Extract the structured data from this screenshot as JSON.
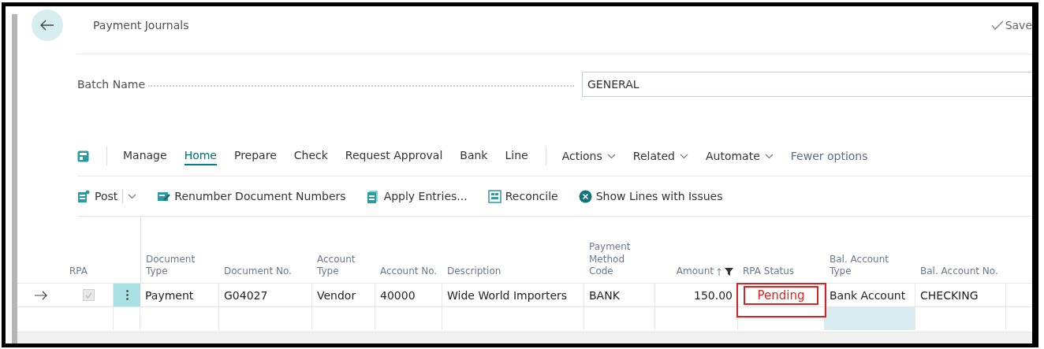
{
  "header": {
    "title": "Payment Journals",
    "save_status": "Save"
  },
  "batch": {
    "label": "Batch Name",
    "value": "GENERAL"
  },
  "action_bar": [
    {
      "kind": "icon"
    },
    {
      "kind": "tab",
      "label": "Manage",
      "selected": false
    },
    {
      "kind": "tab",
      "label": "Home",
      "selected": true
    },
    {
      "kind": "tab",
      "label": "Prepare",
      "selected": false
    },
    {
      "kind": "tab",
      "label": "Check",
      "selected": false
    },
    {
      "kind": "tab",
      "label": "Request Approval",
      "selected": false
    },
    {
      "kind": "tab",
      "label": "Bank",
      "selected": false
    },
    {
      "kind": "tab",
      "label": "Line",
      "selected": false
    },
    {
      "kind": "menu",
      "label": "Actions"
    },
    {
      "kind": "menu",
      "label": "Related"
    },
    {
      "kind": "menu",
      "label": "Automate"
    },
    {
      "kind": "link",
      "label": "Fewer options"
    }
  ],
  "toolbar": [
    {
      "kind": "post",
      "label": "Post"
    },
    {
      "kind": "renumber",
      "label": "Renumber Document Numbers"
    },
    {
      "kind": "apply",
      "label": "Apply Entries..."
    },
    {
      "kind": "reconcile",
      "label": "Reconcile"
    },
    {
      "kind": "issues",
      "label": "Show Lines with Issues"
    }
  ],
  "table": {
    "columns": [
      {
        "label": "RPA"
      },
      {
        "label": "Document Type"
      },
      {
        "label": "Document No."
      },
      {
        "label": "Account Type"
      },
      {
        "label": "Account No."
      },
      {
        "label": "Description"
      },
      {
        "label": "Payment Method Code"
      },
      {
        "label": "Amount",
        "sorted": true,
        "filtered": true
      },
      {
        "label": "RPA Status",
        "highlighted": true
      },
      {
        "label": "Bal. Account Type"
      },
      {
        "label": "Bal. Account No."
      }
    ],
    "rows": [
      {
        "current": true,
        "cells": [
          {
            "kind": "checkbox",
            "checked": true,
            "focused": false
          },
          {
            "text": "Payment",
            "focused": false
          },
          {
            "text": "G04027",
            "focused": false
          },
          {
            "text": "Vendor",
            "focused": false
          },
          {
            "text": "40000",
            "focused": false
          },
          {
            "text": "Wide World Importers",
            "focused": false
          },
          {
            "text": "BANK",
            "focused": false
          },
          {
            "kind": "number",
            "text": "150.00",
            "focused": false
          },
          {
            "text": "Pending",
            "focused": false,
            "highlighted": true
          },
          {
            "text": "Bank Account",
            "focused": false
          },
          {
            "text": "CHECKING",
            "focused": false
          }
        ]
      },
      {
        "current": false,
        "cells": [
          {
            "focused": false
          },
          {
            "focused": false
          },
          {
            "focused": false
          },
          {
            "focused": false
          },
          {
            "focused": false
          },
          {
            "focused": false
          },
          {
            "focused": false
          },
          {
            "focused": false
          },
          {
            "focused": false
          },
          {
            "focused": true
          },
          {
            "focused": false
          }
        ]
      }
    ]
  }
}
